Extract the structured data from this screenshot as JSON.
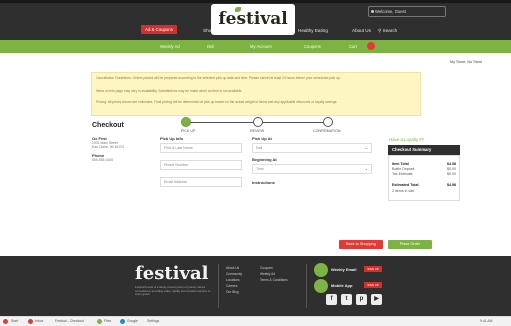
{
  "header": {
    "logo": "festival",
    "account_label": "Welcome, Guest",
    "nav": [
      "Shop",
      "Exclusive Offers",
      "Healthy Eating",
      "About Us",
      "Search"
    ],
    "ad_button": "Ad & Coupons"
  },
  "subnav": {
    "items": [
      "Weekly Ad",
      "Deli",
      "My Account",
      "Coupons",
      "Cart"
    ],
    "cart_count": "0"
  },
  "user_line": "My Store: No Store",
  "notice": {
    "lines": [
      "Cancellation Guidelines: Orders placed will be prepared according to the selected pick up date and time. Please cancel at least 24 hours before your scheduled pick up.",
      "Items on this page may vary in availability. Substitutions may be made when an item is not available.",
      "Pricing: All prices shown are estimates. Final pricing will be determined at pick up based on the actual weight of items and any applicable discounts or loyalty savings."
    ]
  },
  "checkout": {
    "title": "Checkout",
    "steps": [
      "PICK UP",
      "REVIEW",
      "CONFIRMATION"
    ],
    "store_label": "Ox Fest",
    "store_text": [
      "1001 Main Street",
      "Eau Claire, WI 54701"
    ],
    "phone_label": "Phone",
    "phone_text": "555-555-0100",
    "pickup_info_label": "Pick Up Info",
    "pickup_field_1": "First & Last Name",
    "pickup_field_2": "Phone Number",
    "pickup_field_3": "Email Address",
    "pickup_at_label": "Pick Up At",
    "pickup_at_value": "Deli",
    "beginning_label": "Beginning At",
    "beginning_value": "Time",
    "instructions_label": "Instructions"
  },
  "summary": {
    "loyalty_link": "Have a Loyalty #?",
    "title": "Checkout Summary",
    "rows": [
      {
        "label": "Item Total",
        "value": "$4.98"
      },
      {
        "label": "Bottle Deposit",
        "value": "$0.00"
      },
      {
        "label": "Tax Estimate",
        "value": "$0.00"
      }
    ],
    "total_label": "Estimated Total",
    "total_value": "$4.98",
    "items_count": "2 items in cart"
  },
  "buttons": {
    "back": "Back to Shopping",
    "place": "Place Order"
  },
  "footer": {
    "logo": "festival",
    "description": "Festival Foods is a family-owned group of grocery stores committed to providing value, quality and excellent service to every guest.",
    "col1": [
      "About Us",
      "Community",
      "Locations",
      "Careers",
      "Our Blog"
    ],
    "col2": [
      "Coupons",
      "Weekly Ad",
      "Terms & Conditions"
    ],
    "brand1": "Weekly Email",
    "brand2": "Mobile App",
    "signup": "SIGN UP",
    "social": [
      "f",
      "t",
      "p",
      "▶"
    ]
  },
  "taskbar": {
    "items": [
      "Start",
      "Inbox",
      "Festival - Checkout",
      "Files",
      "Google",
      "Settings"
    ],
    "clock": "9:41 AM"
  }
}
